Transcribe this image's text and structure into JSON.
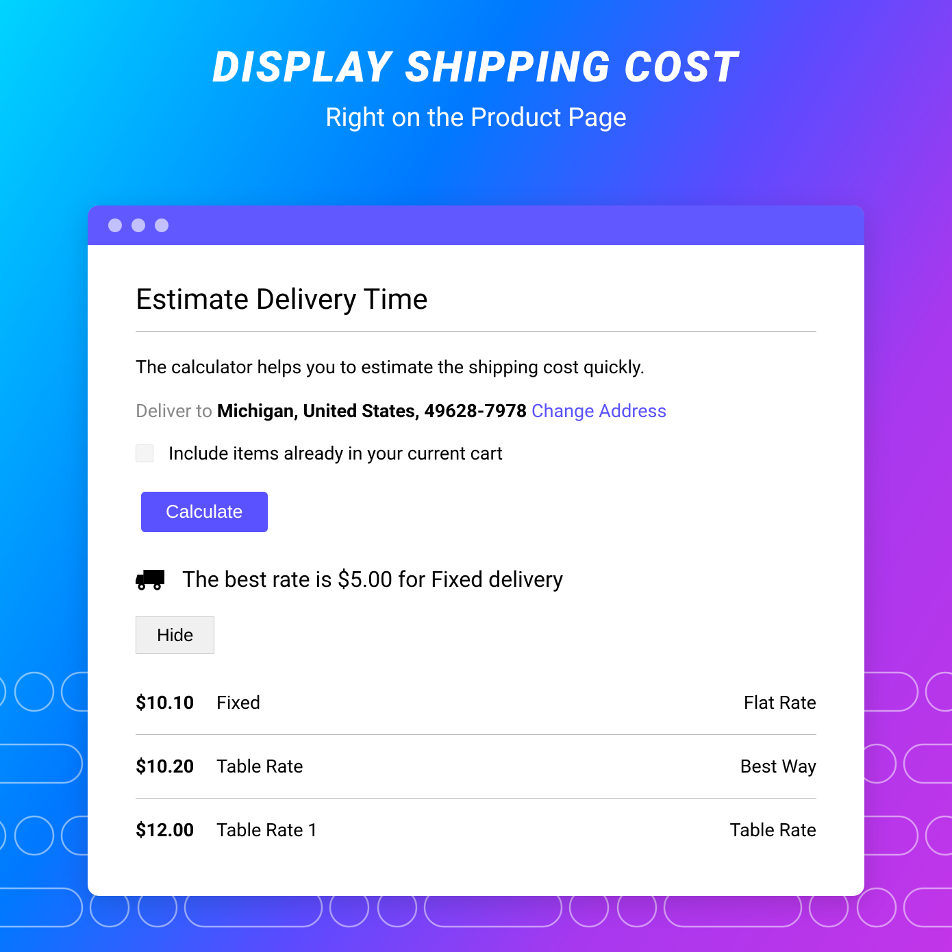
{
  "header": {
    "title": "DISPLAY SHIPPING COST",
    "subtitle": "Right on the Product Page"
  },
  "panel": {
    "title": "Estimate Delivery Time",
    "description": "The calculator helps you to estimate the shipping cost quickly.",
    "deliver_prefix": "Deliver to ",
    "deliver_location": "Michigan, United States, 49628-7978",
    "change_link": "Change Address",
    "checkbox_label": "Include items already in your current cart",
    "calculate_label": "Calculate",
    "best_rate": "The best rate is $5.00 for Fixed delivery",
    "hide_label": "Hide",
    "rates": [
      {
        "price": "$10.10",
        "name": "Fixed",
        "type": "Flat Rate"
      },
      {
        "price": "$10.20",
        "name": "Table Rate",
        "type": "Best Way"
      },
      {
        "price": "$12.00",
        "name": "Table Rate 1",
        "type": "Table Rate"
      }
    ]
  }
}
